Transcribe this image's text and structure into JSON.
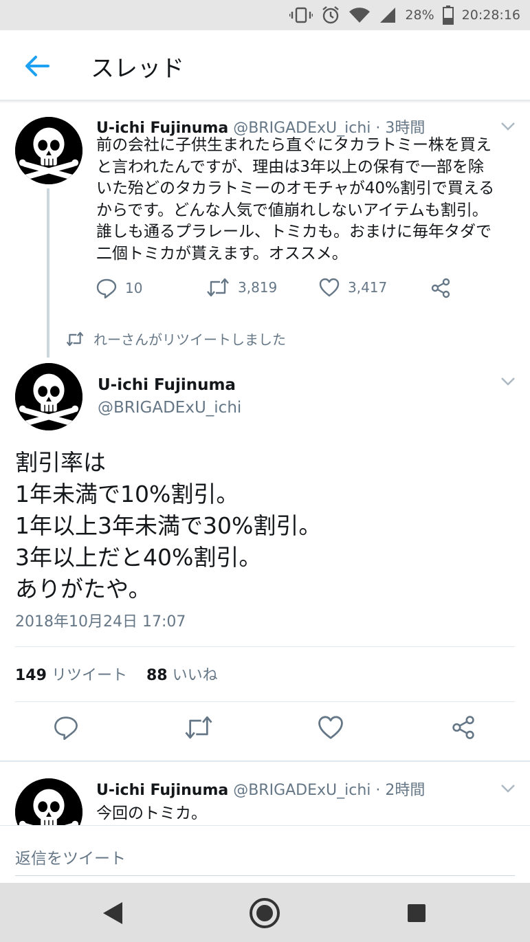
{
  "status_bar": {
    "battery": "28%",
    "time": "20:28:16"
  },
  "app_bar": {
    "title": "スレッド"
  },
  "tweet1": {
    "name": "U-ichi Fujinuma",
    "handle": "@BRIGADExU_ichi",
    "time": "· 3時間",
    "lines": [
      "前の会社に子供生まれたら直ぐにタカラトミー株を買え",
      "と言われたんですが、理由は3年以上の保有で一部を除",
      "いた殆どのタカラトミーのオモチャが40%割引で買える",
      "からです。どんな人気で値崩れしないアイテムも割引。",
      "誰しも通るプラレール、トミカも。おまけに毎年タダで",
      "二個トミカが貰えます。オススメ。"
    ],
    "replies": "10",
    "retweets": "3,819",
    "likes": "3,417"
  },
  "retweet_notice": "れーさんがリツイートしました",
  "tweet2": {
    "name": "U-ichi Fujinuma",
    "handle": "@BRIGADExU_ichi",
    "lines": [
      "割引率は",
      "1年未満で10%割引。",
      "1年以上3年未満で30%割引。",
      "3年以上だと40%割引。",
      "ありがたや。"
    ],
    "date": "2018年10月24日 17:07",
    "retweet_count": "149",
    "retweet_label": "リツイート",
    "like_count": "88",
    "like_label": "いいね"
  },
  "tweet3": {
    "name": "U-ichi Fujinuma",
    "handle": "@BRIGADExU_ichi",
    "time": "· 2時間",
    "text": "今回のトミカ。"
  },
  "reply_placeholder": "返信をツイート",
  "colors": {
    "accent": "#1da1f2",
    "muted": "#657786",
    "text": "#14171a"
  }
}
